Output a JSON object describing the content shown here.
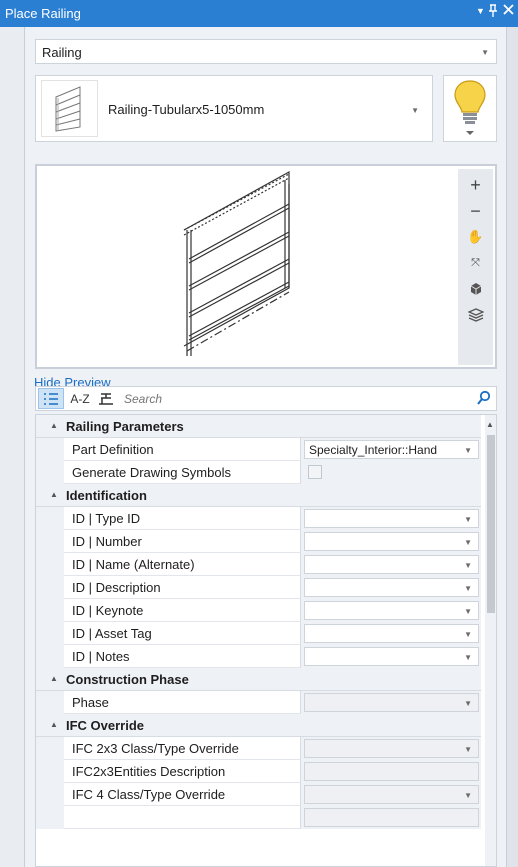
{
  "window": {
    "title": "Place Railing",
    "pin_icon": "pin-icon",
    "close_icon": "close-icon"
  },
  "type_select": {
    "value": "Railing"
  },
  "family_select": {
    "value": "Railing-Tubularx5-1050mm"
  },
  "preview": {
    "hide_label": "Hide Preview"
  },
  "toolbar": {
    "az_label": "A-Z",
    "search_placeholder": "Search"
  },
  "properties": {
    "railing": {
      "label": "Railing Parameters",
      "rows": [
        {
          "name": "Part Definition",
          "value": "Specialty_Interior::Hand"
        },
        {
          "name": "Generate Drawing Symbols"
        }
      ]
    },
    "identification": {
      "label": "Identification",
      "rows": [
        {
          "name": "ID | Type ID"
        },
        {
          "name": "ID | Number"
        },
        {
          "name": "ID | Name (Alternate)"
        },
        {
          "name": "ID | Description"
        },
        {
          "name": "ID | Keynote"
        },
        {
          "name": "ID | Asset Tag"
        },
        {
          "name": "ID | Notes"
        }
      ]
    },
    "construction": {
      "label": "Construction Phase",
      "rows": [
        {
          "name": "Phase"
        }
      ]
    },
    "ifc": {
      "label": "IFC Override",
      "rows": [
        {
          "name": "IFC 2x3 Class/Type Override"
        },
        {
          "name": "IFC2x3Entities Description"
        },
        {
          "name": "IFC 4 Class/Type Override"
        }
      ]
    }
  },
  "colors": {
    "title_bar": "#2b7fd3",
    "link": "#1a6fc4",
    "bulb": "#f7d34a"
  }
}
